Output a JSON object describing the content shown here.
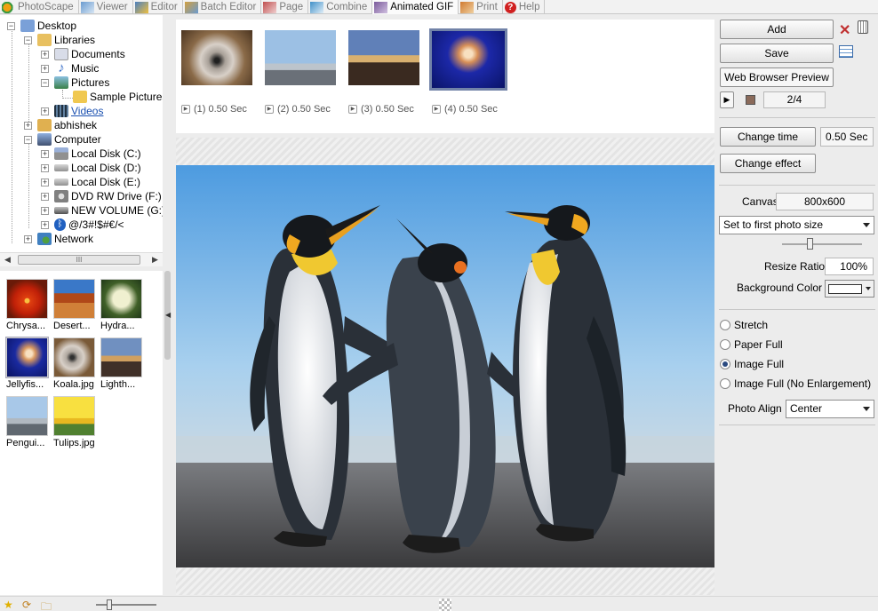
{
  "tabs": [
    {
      "label": "PhotoScape",
      "icon": "photoscape-icon",
      "color": "#f0a010"
    },
    {
      "label": "Viewer",
      "icon": "viewer-icon",
      "color": "#6a9bd0"
    },
    {
      "label": "Editor",
      "icon": "editor-icon",
      "color": "#4a7fc0"
    },
    {
      "label": "Batch Editor",
      "icon": "batch-editor-icon",
      "color": "#d2a040"
    },
    {
      "label": "Page",
      "icon": "page-icon",
      "color": "#c05050"
    },
    {
      "label": "Combine",
      "icon": "combine-icon",
      "color": "#4090c8"
    },
    {
      "label": "Animated GIF",
      "icon": "animated-gif-icon",
      "color": "#7a5a9a"
    },
    {
      "label": "Print",
      "icon": "print-icon",
      "color": "#d07a30"
    },
    {
      "label": "Help",
      "icon": "help-icon",
      "color": "#d02020"
    }
  ],
  "active_tab": "Animated GIF",
  "tree": [
    {
      "label": "Desktop",
      "icon": "desktop-icon",
      "color": "#7aa0d8"
    },
    {
      "label": "Libraries",
      "icon": "libraries-icon",
      "color": "#e8c060"
    },
    {
      "label": "Documents",
      "icon": "documents-icon",
      "color": "#d8dce8"
    },
    {
      "label": "Music",
      "icon": "music-icon",
      "color": "#3a70c8"
    },
    {
      "label": "Pictures",
      "icon": "pictures-icon",
      "color": "#58a0c8"
    },
    {
      "label": "Sample Pictures",
      "icon": "folder-icon",
      "color": "#f0c850"
    },
    {
      "label": "Videos",
      "icon": "videos-icon",
      "color": "#305070"
    },
    {
      "label": "abhishek",
      "icon": "user-folder-icon",
      "color": "#e0b050"
    },
    {
      "label": "Computer",
      "icon": "computer-icon",
      "color": "#6080b0"
    },
    {
      "label": "Local Disk (C:)",
      "icon": "disk-c-icon",
      "color": "#909090"
    },
    {
      "label": "Local Disk (D:)",
      "icon": "disk-icon",
      "color": "#a8a8a8"
    },
    {
      "label": "Local Disk (E:)",
      "icon": "disk-icon",
      "color": "#a8a8a8"
    },
    {
      "label": "DVD RW Drive (F:)",
      "icon": "dvd-drive-icon",
      "color": "#808080"
    },
    {
      "label": "NEW VOLUME (G:)",
      "icon": "disk-icon",
      "color": "#707070"
    },
    {
      "label": "@/3#!$#€/<",
      "icon": "bluetooth-icon",
      "color": "#2060c0"
    },
    {
      "label": "Network",
      "icon": "network-icon",
      "color": "#4080c0"
    }
  ],
  "tree_scroll_label": "III",
  "thumbnails": [
    {
      "caption": "Chrysa...",
      "image": "chrysanthemum"
    },
    {
      "caption": "Desert...",
      "image": "desert"
    },
    {
      "caption": "Hydra...",
      "image": "hydrangeas"
    },
    {
      "caption": "Jellyfis...",
      "image": "jellyfish"
    },
    {
      "caption": "Koala.jpg",
      "image": "koala"
    },
    {
      "caption": "Lighth...",
      "image": "lighthouse"
    },
    {
      "caption": "Pengui...",
      "image": "penguins"
    },
    {
      "caption": "Tulips.jpg",
      "image": "tulips"
    }
  ],
  "frames": [
    {
      "label": "(1) 0.50 Sec",
      "image": "koala"
    },
    {
      "label": "(2) 0.50 Sec",
      "image": "penguins"
    },
    {
      "label": "(3) 0.50 Sec",
      "image": "lighthouse"
    },
    {
      "label": "(4) 0.50 Sec",
      "image": "jellyfish"
    }
  ],
  "selected_frame": 4,
  "right": {
    "add_label": "Add",
    "save_label": "Save",
    "web_preview_label": "Web Browser Preview",
    "frame_counter": "2/4",
    "change_time_label": "Change time",
    "time_value": "0.50 Sec",
    "change_effect_label": "Change effect",
    "canvas_label": "Canvas",
    "canvas_value": "800x600",
    "size_select": "Set to first photo size",
    "resize_label": "Resize Ratio",
    "resize_value": "100%",
    "bg_color_label": "Background Color",
    "bg_color": "#ffffff",
    "radios": [
      "Stretch",
      "Paper Full",
      "Image Full",
      "Image Full (No Enlargement)"
    ],
    "radio_selected": "Image Full",
    "photo_align_label": "Photo Align",
    "photo_align_value": "Center"
  },
  "colors": {
    "frame_selected": "#7283a8",
    "radio_dot": "#2b4a80"
  }
}
